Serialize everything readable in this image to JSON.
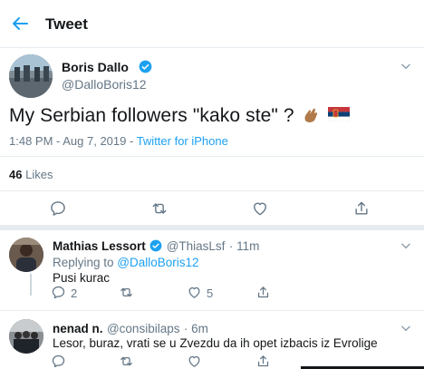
{
  "header": {
    "title": "Tweet"
  },
  "tweet": {
    "author_name": "Boris Dallo",
    "author_handle": "@DalloBoris12",
    "text": "My Serbian followers \"kako ste\" ?",
    "timestamp": "1:48 PM - Aug 7, 2019 - ",
    "source": "Twitter for iPhone",
    "likes_count": "46",
    "likes_label": "Likes"
  },
  "replies": [
    {
      "author_name": "Mathias Lessort",
      "author_handle": "@ThiasLsf",
      "time": "· 11m",
      "replying_prefix": "Replying to ",
      "replying_to": "@DalloBoris12",
      "text": "Pusi kurac",
      "reply_count": "2",
      "like_count": "5"
    },
    {
      "author_name": "nenad n.",
      "author_handle": "@consibilaps",
      "time": "· 6m",
      "text": "Lesor, buraz, vrati se u Zvezdu da ih opet izbacis iz Evrolige"
    }
  ],
  "colors": {
    "accent": "#1da1f2",
    "secondary_text": "#657786",
    "divider": "#e6ecf0"
  },
  "icons": {
    "back": "arrow-left-icon",
    "verified": "verified-badge-icon",
    "more": "chevron-down-icon",
    "reply": "comment-icon",
    "retweet": "retweet-icon",
    "like": "heart-icon",
    "share": "share-icon",
    "emoji_hand": "pinching-hand-emoji",
    "emoji_flag": "serbia-flag-emoji"
  }
}
